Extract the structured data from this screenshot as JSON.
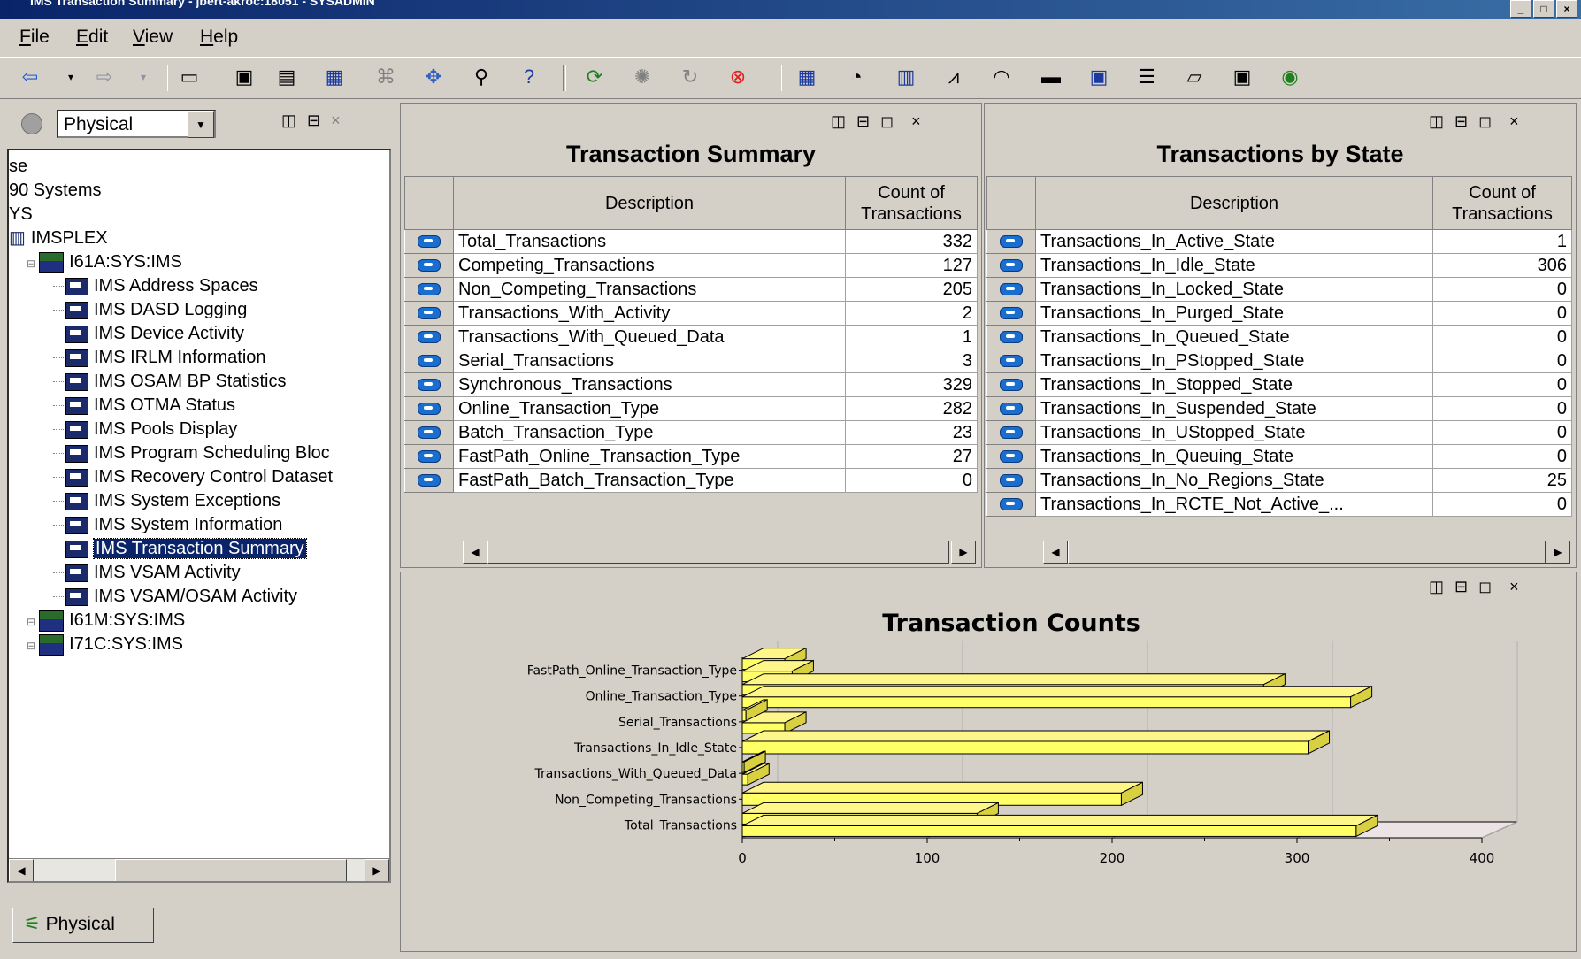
{
  "window": {
    "title": "IMS Transaction Summary - jbert-akroc:18051 - SYSADMIN"
  },
  "menu": [
    {
      "mnemonic": "F",
      "rest": "ile"
    },
    {
      "mnemonic": "E",
      "rest": "dit"
    },
    {
      "mnemonic": "V",
      "rest": "iew"
    },
    {
      "mnemonic": "H",
      "rest": "elp"
    }
  ],
  "toolbar": [
    "back-icon",
    "forward-icon",
    "new-workspace-icon",
    "save-icon",
    "properties-icon",
    "view-properties-icon",
    "link-icon",
    "navigator-icon",
    "find-icon",
    "help-icon",
    "refresh-icon",
    "stop-refresh-icon",
    "reload-icon",
    "stop-icon",
    "table-view-icon",
    "pie-chart-icon",
    "bar-chart-icon",
    "plot-chart-icon",
    "gauge-icon",
    "notepad-icon",
    "event-console-icon",
    "message-log-icon",
    "graphic-view-icon",
    "terminal-view-icon",
    "browser-icon"
  ],
  "navigator": {
    "view": "Physical",
    "tab": "Physical",
    "items": [
      {
        "label": "se",
        "depth": 0,
        "kind": "text"
      },
      {
        "label": "90 Systems",
        "depth": 0,
        "kind": "text"
      },
      {
        "label": "YS",
        "depth": 0,
        "kind": "text"
      },
      {
        "label": "IMSPLEX",
        "depth": 0,
        "kind": "plex"
      },
      {
        "label": "I61A:SYS:IMS",
        "depth": 1,
        "kind": "system"
      },
      {
        "label": "IMS Address Spaces",
        "depth": 2,
        "kind": "ws"
      },
      {
        "label": "IMS DASD Logging",
        "depth": 2,
        "kind": "ws"
      },
      {
        "label": "IMS Device Activity",
        "depth": 2,
        "kind": "ws"
      },
      {
        "label": "IMS IRLM Information",
        "depth": 2,
        "kind": "ws"
      },
      {
        "label": "IMS OSAM BP Statistics",
        "depth": 2,
        "kind": "ws"
      },
      {
        "label": "IMS OTMA Status",
        "depth": 2,
        "kind": "ws"
      },
      {
        "label": "IMS Pools Display",
        "depth": 2,
        "kind": "ws"
      },
      {
        "label": "IMS Program Scheduling Bloc",
        "depth": 2,
        "kind": "ws"
      },
      {
        "label": "IMS Recovery Control Dataset",
        "depth": 2,
        "kind": "ws"
      },
      {
        "label": "IMS System Exceptions",
        "depth": 2,
        "kind": "ws"
      },
      {
        "label": "IMS System Information",
        "depth": 2,
        "kind": "ws"
      },
      {
        "label": "IMS Transaction Summary",
        "depth": 2,
        "kind": "ws",
        "selected": true
      },
      {
        "label": "IMS VSAM Activity",
        "depth": 2,
        "kind": "ws"
      },
      {
        "label": "IMS VSAM/OSAM Activity",
        "depth": 2,
        "kind": "ws"
      },
      {
        "label": "I61M:SYS:IMS",
        "depth": 1,
        "kind": "system"
      },
      {
        "label": "I71C:SYS:IMS",
        "depth": 1,
        "kind": "system"
      }
    ]
  },
  "summary": {
    "title": "Transaction Summary",
    "col_desc": "Description",
    "col_count": "Count of Transactions",
    "rows": [
      {
        "desc": "Total_Transactions",
        "count": "332"
      },
      {
        "desc": "Competing_Transactions",
        "count": "127"
      },
      {
        "desc": "Non_Competing_Transactions",
        "count": "205"
      },
      {
        "desc": "Transactions_With_Activity",
        "count": "2"
      },
      {
        "desc": "Transactions_With_Queued_Data",
        "count": "1"
      },
      {
        "desc": "Serial_Transactions",
        "count": "3"
      },
      {
        "desc": "Synchronous_Transactions",
        "count": "329"
      },
      {
        "desc": "Online_Transaction_Type",
        "count": "282"
      },
      {
        "desc": "Batch_Transaction_Type",
        "count": "23"
      },
      {
        "desc": "FastPath_Online_Transaction_Type",
        "count": "27"
      },
      {
        "desc": "FastPath_Batch_Transaction_Type",
        "count": "0"
      }
    ]
  },
  "bystate": {
    "title": "Transactions by State",
    "col_desc": "Description",
    "col_count": "Count of Transactions",
    "rows": [
      {
        "desc": "Transactions_In_Active_State",
        "count": "1"
      },
      {
        "desc": "Transactions_In_Idle_State",
        "count": "306"
      },
      {
        "desc": "Transactions_In_Locked_State",
        "count": "0"
      },
      {
        "desc": "Transactions_In_Purged_State",
        "count": "0"
      },
      {
        "desc": "Transactions_In_Queued_State",
        "count": "0"
      },
      {
        "desc": "Transactions_In_PStopped_State",
        "count": "0"
      },
      {
        "desc": "Transactions_In_Stopped_State",
        "count": "0"
      },
      {
        "desc": "Transactions_In_Suspended_State",
        "count": "0"
      },
      {
        "desc": "Transactions_In_UStopped_State",
        "count": "0"
      },
      {
        "desc": "Transactions_In_Queuing_State",
        "count": "0"
      },
      {
        "desc": "Transactions_In_No_Regions_State",
        "count": "25"
      },
      {
        "desc": "Transactions_In_RCTE_Not_Active_...",
        "count": "0"
      }
    ]
  },
  "chart_data": {
    "type": "bar",
    "orientation": "horizontal",
    "title": "Transaction Counts",
    "xlim": [
      0,
      400
    ],
    "xticks": [
      0,
      100,
      200,
      300,
      400
    ],
    "categories": [
      "FastPath_Online_Transaction_Type",
      "Online_Transaction_Type",
      "Serial_Transactions",
      "Transactions_In_Idle_State",
      "Transactions_With_Queued_Data",
      "Non_Competing_Transactions",
      "Total_Transactions"
    ],
    "bars": [
      {
        "category": "FastPath_Online_Transaction_Type",
        "values": [
          23,
          27
        ]
      },
      {
        "category": "Online_Transaction_Type",
        "values": [
          282,
          329
        ]
      },
      {
        "category": "Serial_Transactions",
        "values": [
          2,
          23
        ]
      },
      {
        "category": "Transactions_In_Idle_State",
        "values": [
          306
        ]
      },
      {
        "category": "Transactions_With_Queued_Data",
        "values": [
          1,
          3
        ]
      },
      {
        "category": "Non_Competing_Transactions",
        "values": [
          205
        ]
      },
      {
        "category": "Total_Transactions",
        "values": [
          127,
          332
        ]
      }
    ],
    "bar_color": "#ffff66",
    "bar_edge": "#000000",
    "grid": true
  }
}
